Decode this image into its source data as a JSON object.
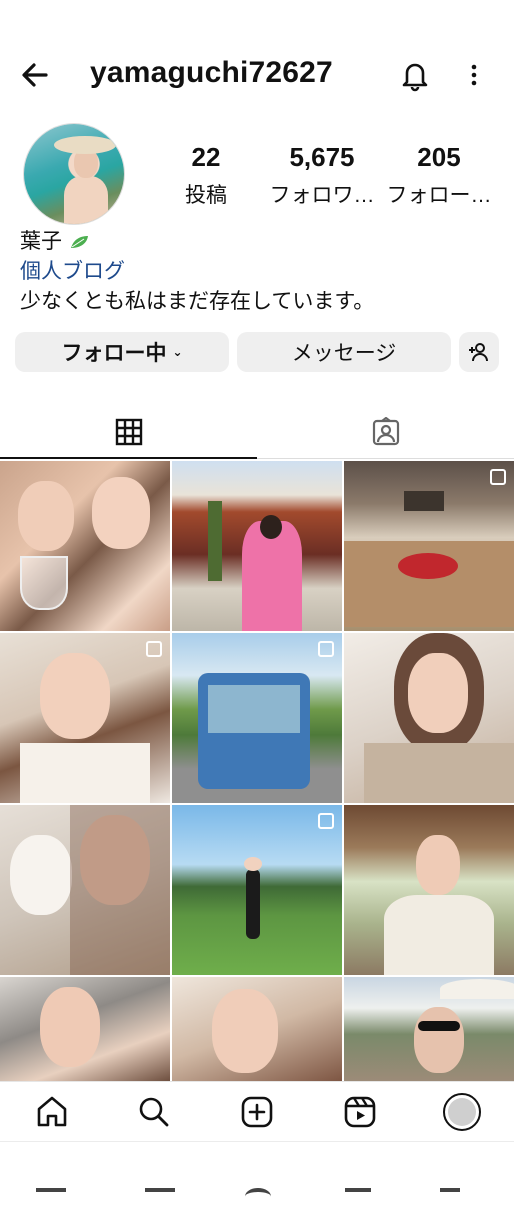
{
  "header": {
    "username": "yamaguchi72627",
    "back_icon": "arrow-left-icon",
    "bell_icon": "bell-icon",
    "more_icon": "more-vertical-icon"
  },
  "stats": {
    "posts_count": "22",
    "posts_label": "投稿",
    "followers_count": "5,675",
    "followers_label": "フォロワ…",
    "following_count": "205",
    "following_label": "フォロー…"
  },
  "bio": {
    "name": "葉子",
    "category": "個人ブログ",
    "text": "少なくとも私はまだ存在しています。"
  },
  "actions": {
    "follow_label": "フォロー中",
    "message_label": "メッセージ",
    "suggest_icon": "add-person-icon"
  },
  "tabs": [
    {
      "icon": "grid-icon",
      "active": true
    },
    {
      "icon": "tagged-person-icon",
      "active": false
    }
  ],
  "posts": [
    {
      "desc": "selfie-two-women-wine",
      "multi": false
    },
    {
      "desc": "shrine-pink-coat",
      "multi": false
    },
    {
      "desc": "sushi-counter",
      "multi": true
    },
    {
      "desc": "selfie-white-dress",
      "multi": true
    },
    {
      "desc": "golf-cart",
      "multi": true
    },
    {
      "desc": "selfie-beige-sweater",
      "multi": false
    },
    {
      "desc": "selfie-with-puppy",
      "multi": false
    },
    {
      "desc": "golf-course",
      "multi": true
    },
    {
      "desc": "terrace-cream-jacket",
      "multi": false
    },
    {
      "desc": "selfie-restaurant",
      "multi": false
    },
    {
      "desc": "selfie-closeup",
      "multi": false
    },
    {
      "desc": "selfie-parasol-sunglasses",
      "multi": false
    }
  ],
  "nav": [
    "home-icon",
    "search-icon",
    "create-icon",
    "reels-icon",
    "profile-avatar"
  ],
  "colors": {
    "accent_link": "#1e4a8c",
    "button_bg": "#efefef"
  }
}
